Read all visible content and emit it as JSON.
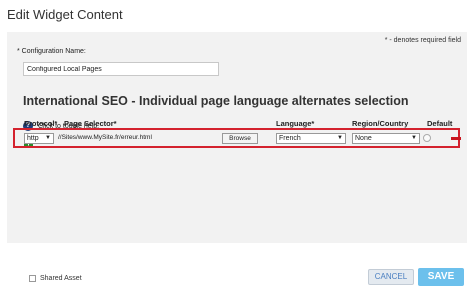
{
  "dialog": {
    "title": "Edit Widget Content"
  },
  "form": {
    "required_note": "* - denotes required field",
    "config_label": "* Configuration Name:",
    "config_value": "Configured Local Pages",
    "section_title": "International SEO - Individual page language alternates selection",
    "help_icon_glyph": "?",
    "help_text": "Click to toggle help.",
    "add_glyph": "+"
  },
  "table": {
    "headers": {
      "protocol": "Protocol*",
      "page_selector": "Page Selector*",
      "language": "Language*",
      "region": "Region/Country",
      "default": "Default"
    },
    "row": {
      "protocol": "http",
      "page_path": "//Sites/www.MySite.fr/erreur.html",
      "browse_label": "Browse",
      "language": "French",
      "region": "None",
      "dropdown_glyph": "▼"
    }
  },
  "footer": {
    "shared_asset_label": "Shared Asset",
    "cancel_label": "CANCEL",
    "save_label": "SAVE"
  },
  "colors": {
    "highlight": "#d4222e",
    "save_bg": "#6cc0ec",
    "add_green": "#2b8a2b",
    "help_blue": "#1f3d7a",
    "remove_red": "#c9151f"
  }
}
